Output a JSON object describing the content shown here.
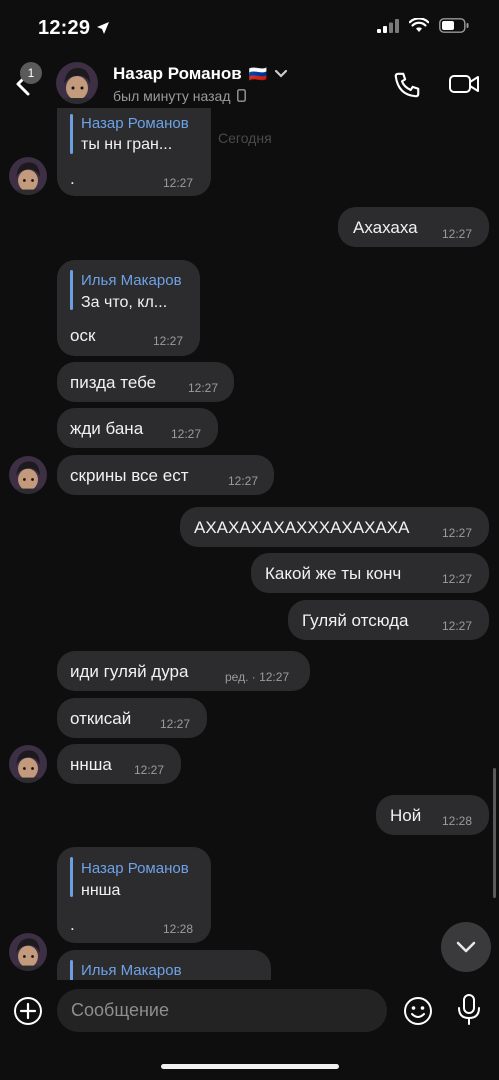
{
  "status_bar": {
    "time": "12:29"
  },
  "header": {
    "back_badge": "1",
    "name": "Назар Романов",
    "flag": "🇷🇺",
    "status": "был минуту назад"
  },
  "date_label": "Сегодня",
  "messages": [
    {
      "dir": "in",
      "reply_name": "Назар Романов",
      "reply_text": "ты нн гран...",
      "text": ".",
      "time": "12:27"
    },
    {
      "dir": "out",
      "text": "Ахахаха",
      "time": "12:27"
    },
    {
      "dir": "in",
      "reply_name": "Илья Макаров",
      "reply_text": "За что, кл...",
      "text": "оск",
      "time": "12:27"
    },
    {
      "dir": "in",
      "text": "пизда тебе",
      "time": "12:27"
    },
    {
      "dir": "in",
      "text": "жди бана",
      "time": "12:27"
    },
    {
      "dir": "in",
      "text": "скрины все ест",
      "time": "12:27"
    },
    {
      "dir": "out",
      "text": "АХАХАХАХАХХХАХАХАХА",
      "time": "12:27"
    },
    {
      "dir": "out",
      "text": "Какой же ты конч",
      "time": "12:27"
    },
    {
      "dir": "out",
      "text": "Гуляй отсюда",
      "time": "12:27"
    },
    {
      "dir": "in",
      "text": "иди гуляй дура",
      "edited": "ред. · 12:27",
      "time": ""
    },
    {
      "dir": "in",
      "text": "откисай",
      "time": "12:27"
    },
    {
      "dir": "in",
      "text": "ннша",
      "time": "12:27"
    },
    {
      "dir": "out",
      "text": "Ной",
      "time": "12:28"
    },
    {
      "dir": "in",
      "reply_name": "Назар Романов",
      "reply_text": "ннша",
      "text": ".",
      "time": "12:28"
    },
    {
      "dir": "in",
      "reply_name": "Илья Макаров",
      "reply_text": "",
      "text": "",
      "time": ""
    }
  ],
  "composer": {
    "placeholder": "Сообщение"
  },
  "icons": {
    "back": "chevron-left-icon",
    "call": "phone-icon",
    "video": "video-camera-icon",
    "add": "plus-circle-icon",
    "emoji": "smiley-icon",
    "mic": "microphone-icon",
    "scroll": "chevron-down-icon"
  },
  "colors": {
    "background": "#0e0e0e",
    "bubble": "#2c2c2e",
    "reply_accent": "#6ea2e6"
  }
}
